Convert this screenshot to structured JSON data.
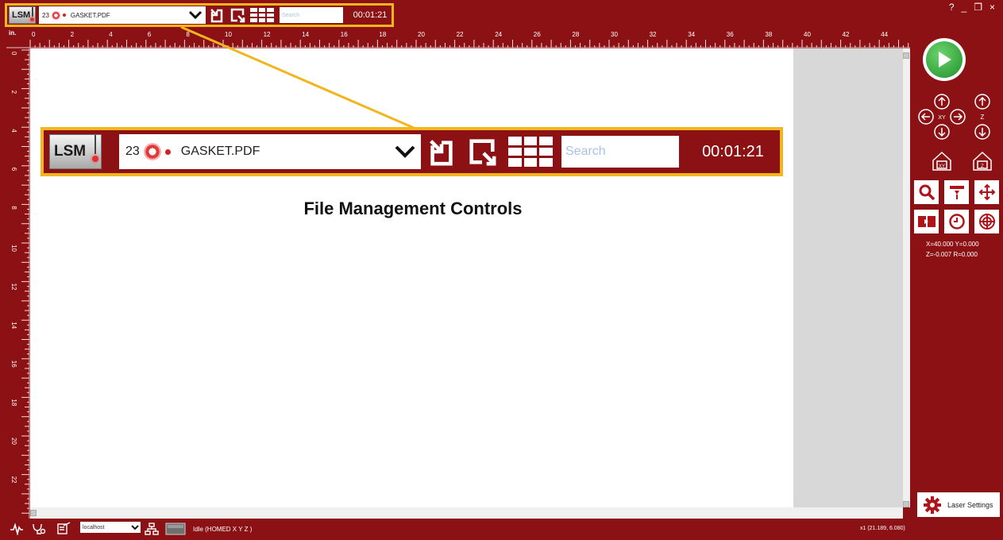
{
  "toolbar": {
    "logo_text": "LSM",
    "file_count": "23",
    "file_name": "GASKET.PDF",
    "search_placeholder": "Search",
    "timer": "00:01:21"
  },
  "window_controls": {
    "help": "?",
    "minimize": "_",
    "restore": "❐",
    "close": "×"
  },
  "ruler": {
    "unit": "in.",
    "top_ticks": [
      "0",
      "2",
      "4",
      "6",
      "8",
      "10",
      "12",
      "14",
      "16",
      "18",
      "20",
      "22",
      "24",
      "26",
      "28",
      "30",
      "32",
      "34",
      "36",
      "38",
      "40",
      "42",
      "44"
    ],
    "left_ticks": [
      "0",
      "2",
      "4",
      "6",
      "8",
      "10",
      "12",
      "14",
      "16",
      "18",
      "20",
      "22"
    ]
  },
  "callout": {
    "logo_text": "LSM",
    "file_count": "23",
    "file_name": "GASKET.PDF",
    "search_placeholder": "Search",
    "timer": "00:01:21",
    "title": "File Management Controls"
  },
  "right_panel": {
    "xy_label": "XY",
    "z_label": "Z",
    "home_xy_label": "XY",
    "home_z_label": "Z",
    "coords_line1": "X=40.000  Y=0.000",
    "coords_line2": "Z=-0.007  R=0.000",
    "laser_settings_label": "Laser Settings"
  },
  "statusbar": {
    "host": "localhost",
    "status": "Idle (HOMED X Y Z )",
    "cursor": "x1  (21.189, 6.080)"
  },
  "colors": {
    "brand_red": "#8b1114",
    "highlight_yellow": "#f1b51d",
    "play_green": "#2aa13a"
  }
}
